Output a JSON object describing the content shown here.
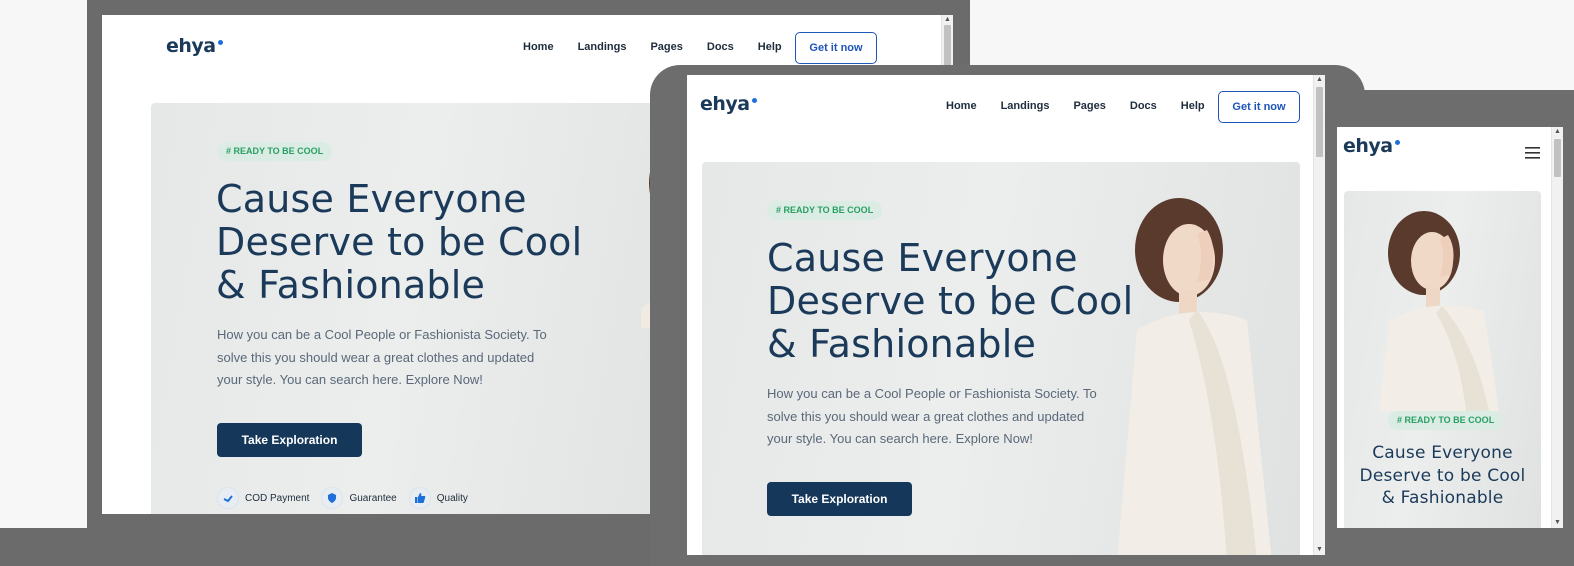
{
  "site": {
    "logo": "ehya",
    "nav": [
      "Home",
      "Landings",
      "Pages",
      "Docs",
      "Help"
    ],
    "cta": "Get it now"
  },
  "hero": {
    "tag": "# READY TO BE COOL",
    "title_lines": [
      "Cause Everyone",
      "Deserve to be Cool",
      "& Fashionable"
    ],
    "description_lines": [
      "How you can be a Cool People or Fashionista Society. To",
      "solve this you should wear a great clothes and updated",
      "your style. You can search here. Explore Now!"
    ],
    "button": "Take Exploration",
    "features": [
      {
        "label": "COD Payment",
        "icon": "wallet-icon"
      },
      {
        "label": "Guarantee",
        "icon": "shield-icon"
      },
      {
        "label": "Quality",
        "icon": "thumbs-up-icon"
      }
    ]
  },
  "colors": {
    "brand": "#1b3a5a",
    "accent": "#1e55b8",
    "tag_text": "#2a9f63",
    "button_bg": "#15385a",
    "device_frame": "#6b6b6b"
  },
  "mobile": {
    "menu_icon": "hamburger-menu-icon"
  }
}
